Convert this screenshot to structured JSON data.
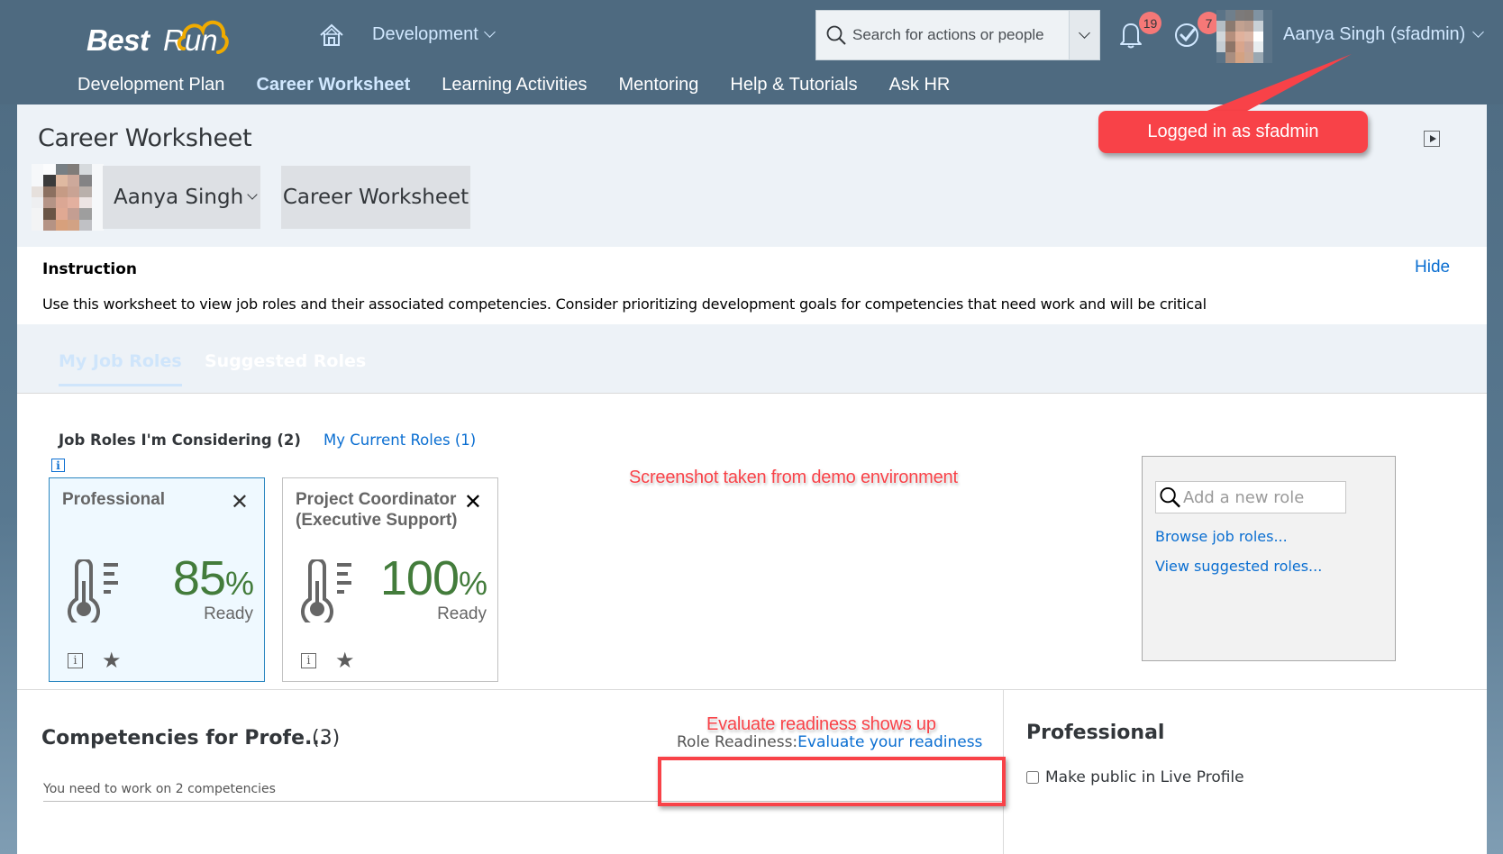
{
  "shell": {
    "logo": {
      "bold": "Best",
      "regular": "Run"
    },
    "module": "Development",
    "search": {
      "placeholder": "Search for actions or people",
      "value": ""
    },
    "notifications_count": "19",
    "tasks_count": "7",
    "user_name": "Aanya Singh (sfadmin)",
    "subnav": [
      {
        "label": "Development Plan",
        "active": false
      },
      {
        "label": "Career Worksheet",
        "active": true
      },
      {
        "label": "Learning Activities",
        "active": false
      },
      {
        "label": "Mentoring",
        "active": false
      },
      {
        "label": "Help & Tutorials",
        "active": false
      },
      {
        "label": "Ask HR",
        "active": false
      }
    ]
  },
  "page": {
    "title": "Career Worksheet",
    "employee_select": "Aanya Singh",
    "worksheet_button": "Career Worksheet"
  },
  "instruction": {
    "title": "Instruction",
    "text": "Use this worksheet to view job roles and their associated competencies. Consider prioritizing development goals for competencies that need work and will be critical",
    "hide_label": "Hide"
  },
  "tabs": [
    {
      "label": "My Job Roles",
      "selected": true
    },
    {
      "label": "Suggested Roles",
      "selected": false
    }
  ],
  "subtabs": {
    "considering": "Job Roles I'm Considering (2)",
    "current": "My Current Roles (1)"
  },
  "role_cards": [
    {
      "title": "Professional",
      "readiness_value": "85",
      "unit": "%",
      "status": "Ready",
      "selected": true
    },
    {
      "title": "Project Coordinator (Executive Support)",
      "readiness_value": "100",
      "unit": "%",
      "status": "Ready",
      "selected": false
    }
  ],
  "add_panel": {
    "placeholder": "Add a new role",
    "browse_link": "Browse job roles...",
    "suggested_link": "View suggested roles..."
  },
  "competencies": {
    "title": "Competencies for Profe...",
    "count": "(3)",
    "subtitle": "You need to work on 2 competencies",
    "readiness_label": "Role Readiness:",
    "readiness_link": "Evaluate your readiness"
  },
  "side_panel": {
    "title": "Professional",
    "make_public_label": "Make public in Live Profile",
    "make_public_checked": false
  },
  "annotations": {
    "logged_in": "Logged in as sfadmin",
    "demo_env": "Screenshot taken from demo environment",
    "evaluate": "Evaluate readiness shows up"
  },
  "colors": {
    "shell_bg": "#4e6a80",
    "link": "#0a6ed1",
    "readiness_green": "#437c3b",
    "badge": "#f67877",
    "annotation_red": "#f84248"
  }
}
